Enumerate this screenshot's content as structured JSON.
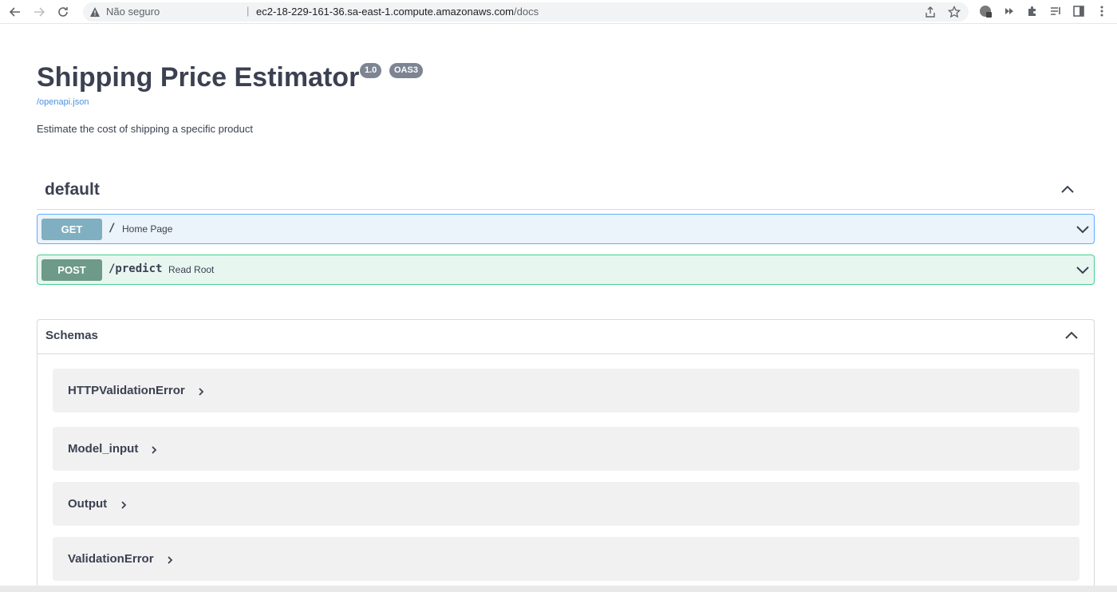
{
  "browser": {
    "security_label": "Não seguro",
    "separator": "|",
    "url_host": "ec2-18-229-161-36.sa-east-1.compute.amazonaws.com",
    "url_path": "/docs"
  },
  "info": {
    "title": "Shipping Price Estimator",
    "version": "1.0",
    "oas_badge": "OAS3",
    "spec_link": "/openapi.json",
    "description": "Estimate the cost of shipping a specific product"
  },
  "tag": {
    "name": "default",
    "operations": [
      {
        "method": "GET",
        "path": "/",
        "summary": "Home Page"
      },
      {
        "method": "POST",
        "path": "/predict",
        "summary": "Read Root"
      }
    ]
  },
  "schemas": {
    "title": "Schemas",
    "items": [
      "HTTPValidationError",
      "Model_input",
      "Output",
      "ValidationError"
    ]
  },
  "colors": {
    "get_border": "#61affe",
    "get_bg": "#ebf3fb",
    "post_border": "#49cc90",
    "post_bg": "#e8f6f0"
  }
}
